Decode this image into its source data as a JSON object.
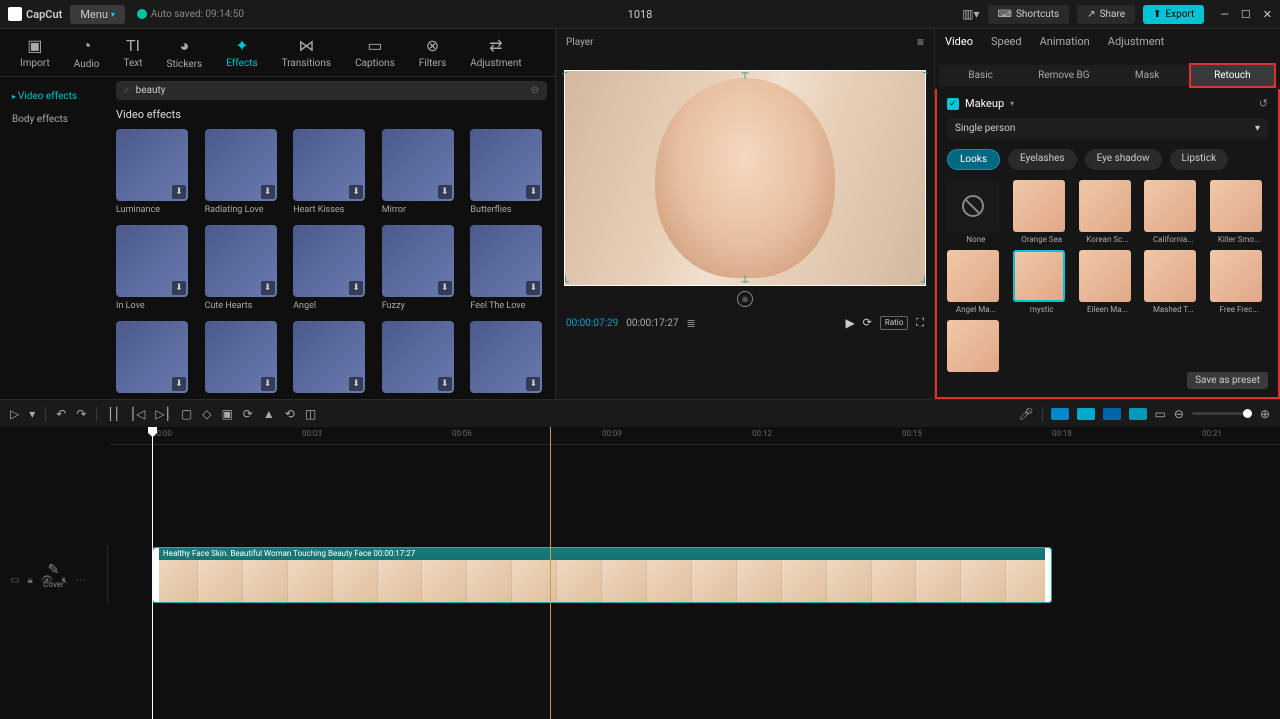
{
  "titlebar": {
    "app": "CapCut",
    "menu": "Menu",
    "autosave": "Auto saved: 09:14:50",
    "title": "1018",
    "shortcuts": "Shortcuts",
    "share": "Share",
    "export": "Export"
  },
  "tools": {
    "import": "Import",
    "audio": "Audio",
    "text": "Text",
    "stickers": "Stickers",
    "effects": "Effects",
    "transitions": "Transitions",
    "captions": "Captions",
    "filters": "Filters",
    "adjustment": "Adjustment"
  },
  "effects_panel": {
    "side_video": "Video effects",
    "side_body": "Body effects",
    "search_value": "beauty",
    "heading": "Video effects",
    "items": [
      "Luminance",
      "Radiating Love",
      "Heart Kisses",
      "Mirror",
      "Butterflies",
      "In Love",
      "Cute Hearts",
      "Angel",
      "Fuzzy",
      "Feel The Love"
    ]
  },
  "player": {
    "label": "Player",
    "time_current": "00:00:07:29",
    "time_duration": "00:00:17:27",
    "ratio": "Ratio"
  },
  "inspector": {
    "tabs": {
      "video": "Video",
      "speed": "Speed",
      "animation": "Animation",
      "adjustment": "Adjustment"
    },
    "subtabs": {
      "basic": "Basic",
      "removebg": "Remove BG",
      "mask": "Mask",
      "retouch": "Retouch"
    },
    "makeup": {
      "title": "Makeup",
      "person": "Single person",
      "pills": {
        "looks": "Looks",
        "eyelashes": "Eyelashes",
        "eyeshadow": "Eye shadow",
        "lipstick": "Lipstick"
      },
      "looks": [
        "None",
        "Orange Sea",
        "Korean Sc...",
        "California...",
        "Killer Smo...",
        "Angel Ma...",
        "mystic",
        "Eileen Ma...",
        "Mashed T...",
        "Free Frec..."
      ],
      "save_preset": "Save as preset"
    }
  },
  "timeline": {
    "cover": "Cover",
    "clip_label": "Healthy Face Skin. Beautiful Woman Touching Beauty Face   00:00:17:27",
    "ticks": [
      "00:00",
      "00:03",
      "00:06",
      "00:09",
      "00:12",
      "00:15",
      "00:18",
      "00:21"
    ]
  }
}
